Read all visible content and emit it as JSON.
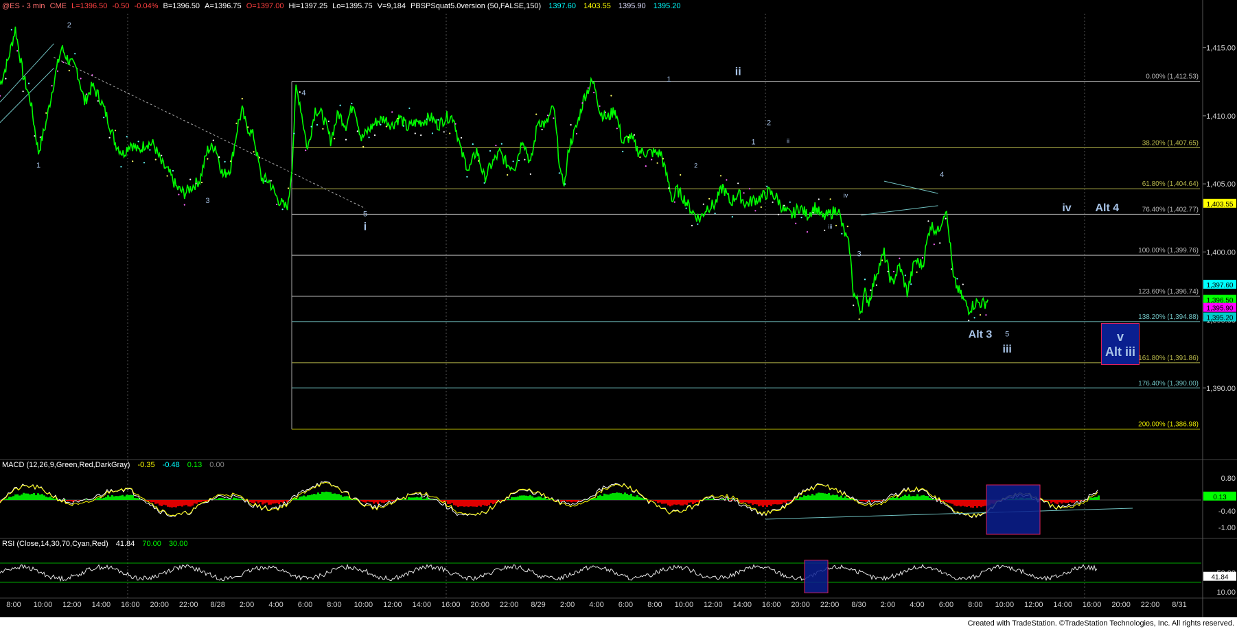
{
  "header": {
    "symbol": "@ES - 3 min",
    "exchange": "CME",
    "last": "L=1396.50",
    "change": "-0.50",
    "change_pct": "-0.04%",
    "bid": "B=1396.50",
    "ask": "A=1396.75",
    "open": "O=1397.00",
    "high": "Hi=1397.25",
    "low": "Lo=1395.75",
    "volume": "V=9,184",
    "study": "PBSPSquat5.0version (50,FALSE,150)",
    "study_v1": "1397.60",
    "study_v2": "1403.55",
    "study_v3": "1395.90",
    "study_v4": "1395.20"
  },
  "colors": {
    "price": "#00ff00",
    "fib_gray": "#b8b8b8",
    "fib_olive": "#b5b54a",
    "fib_teal": "#6fc0c0",
    "fib_yellow": "#e6e600",
    "label": "#a8c4e8",
    "box_fill": "#0a1f8f",
    "box_border": "#e0205a"
  },
  "chart_data": [
    {
      "type": "line",
      "name": "price",
      "ylim": [
        1385.0,
        1417.5
      ],
      "yticks": [
        "1,415.00",
        "1,410.00",
        "1,405.00",
        "1,400.00",
        "1,395.00",
        "1,390.00"
      ],
      "yticks_values": [
        1415,
        1410,
        1405,
        1400,
        1395,
        1390
      ],
      "x_labels": [
        "8:00",
        "10:00",
        "12:00",
        "14:00",
        "16:00",
        "20:00",
        "22:00",
        "8/28",
        "2:00",
        "4:00",
        "6:00",
        "8:00",
        "10:00",
        "12:00",
        "14:00",
        "16:00",
        "20:00",
        "22:00",
        "8/29",
        "2:00",
        "4:00",
        "6:00",
        "8:00",
        "10:00",
        "12:00",
        "14:00",
        "16:00",
        "20:00",
        "22:00",
        "8/30",
        "2:00",
        "4:00",
        "6:00",
        "8:00",
        "10:00",
        "12:00",
        "14:00",
        "16:00",
        "20:00",
        "22:00",
        "8/31"
      ],
      "price_path": [
        [
          0,
          1412.3
        ],
        [
          4,
          1414.0
        ],
        [
          8,
          1416.4
        ],
        [
          12,
          1413.0
        ],
        [
          16,
          1411.0
        ],
        [
          20,
          1407.3
        ],
        [
          24,
          1409.5
        ],
        [
          28,
          1412.5
        ],
        [
          32,
          1415.0
        ],
        [
          36,
          1414.0
        ],
        [
          40,
          1413.4
        ],
        [
          44,
          1411.0
        ],
        [
          48,
          1412.2
        ],
        [
          52,
          1411.3
        ],
        [
          56,
          1409.8
        ],
        [
          60,
          1408.0
        ],
        [
          64,
          1407.2
        ],
        [
          68,
          1408.0
        ],
        [
          72,
          1407.4
        ],
        [
          76,
          1408.0
        ],
        [
          80,
          1407.9
        ],
        [
          84,
          1406.5
        ],
        [
          88,
          1405.8
        ],
        [
          92,
          1404.7
        ],
        [
          96,
          1404.3
        ],
        [
          100,
          1404.8
        ],
        [
          104,
          1405.3
        ],
        [
          108,
          1407.5
        ],
        [
          112,
          1407.8
        ],
        [
          116,
          1405.6
        ],
        [
          120,
          1406.2
        ],
        [
          124,
          1409.5
        ],
        [
          126,
          1410.4
        ],
        [
          128,
          1409.3
        ],
        [
          132,
          1408.5
        ],
        [
          136,
          1405.4
        ],
        [
          140,
          1405.2
        ],
        [
          144,
          1404.0
        ],
        [
          148,
          1403.3
        ],
        [
          150,
          1403.5
        ],
        [
          152,
          1406.5
        ],
        [
          154,
          1412.0
        ],
        [
          156,
          1411.0
        ],
        [
          160,
          1407.5
        ],
        [
          164,
          1410.5
        ],
        [
          168,
          1410.0
        ],
        [
          172,
          1408.2
        ],
        [
          176,
          1410.2
        ],
        [
          180,
          1409.3
        ],
        [
          184,
          1411.0
        ],
        [
          188,
          1408.3
        ],
        [
          192,
          1409.0
        ],
        [
          196,
          1409.6
        ],
        [
          200,
          1409.8
        ],
        [
          204,
          1409.3
        ],
        [
          208,
          1409.9
        ],
        [
          212,
          1409.1
        ],
        [
          216,
          1409.5
        ],
        [
          220,
          1409.6
        ],
        [
          224,
          1409.9
        ],
        [
          228,
          1409.3
        ],
        [
          232,
          1409.9
        ],
        [
          236,
          1409.9
        ],
        [
          240,
          1407.3
        ],
        [
          244,
          1406.0
        ],
        [
          248,
          1407.5
        ],
        [
          252,
          1405.4
        ],
        [
          256,
          1406.5
        ],
        [
          260,
          1407.3
        ],
        [
          264,
          1406.4
        ],
        [
          268,
          1406.3
        ],
        [
          272,
          1408.4
        ],
        [
          276,
          1406.4
        ],
        [
          280,
          1409.7
        ],
        [
          284,
          1409.3
        ],
        [
          288,
          1410.7
        ],
        [
          292,
          1405.3
        ],
        [
          294,
          1405.2
        ],
        [
          296,
          1407.7
        ],
        [
          300,
          1409.2
        ],
        [
          304,
          1411.4
        ],
        [
          308,
          1412.5
        ],
        [
          310,
          1412.0
        ],
        [
          312,
          1410.3
        ],
        [
          316,
          1409.8
        ],
        [
          320,
          1410.5
        ],
        [
          324,
          1408.0
        ],
        [
          328,
          1408.5
        ],
        [
          332,
          1407.4
        ],
        [
          336,
          1407.3
        ],
        [
          340,
          1407.3
        ],
        [
          344,
          1407.2
        ],
        [
          346,
          1406.0
        ],
        [
          348,
          1405.0
        ],
        [
          350,
          1403.7
        ],
        [
          352,
          1404.6
        ],
        [
          356,
          1403.9
        ],
        [
          360,
          1403.0
        ],
        [
          364,
          1402.4
        ],
        [
          368,
          1403.3
        ],
        [
          372,
          1403.5
        ],
        [
          376,
          1404.8
        ],
        [
          380,
          1403.6
        ],
        [
          384,
          1404.3
        ],
        [
          388,
          1403.5
        ],
        [
          392,
          1403.8
        ],
        [
          396,
          1404.0
        ],
        [
          400,
          1404.4
        ],
        [
          404,
          1404.0
        ],
        [
          408,
          1403.0
        ],
        [
          412,
          1402.7
        ],
        [
          416,
          1403.3
        ],
        [
          420,
          1402.7
        ],
        [
          424,
          1403.3
        ],
        [
          428,
          1402.5
        ],
        [
          432,
          1402.8
        ],
        [
          436,
          1403.2
        ],
        [
          438,
          1402.0
        ],
        [
          442,
          1400.3
        ],
        [
          444,
          1397.0
        ],
        [
          446,
          1396.4
        ],
        [
          448,
          1395.7
        ],
        [
          450,
          1397.0
        ],
        [
          452,
          1396.3
        ],
        [
          456,
          1398.5
        ],
        [
          460,
          1399.9
        ],
        [
          464,
          1397.6
        ],
        [
          468,
          1399.0
        ],
        [
          472,
          1397.0
        ],
        [
          476,
          1399.4
        ],
        [
          480,
          1399.0
        ],
        [
          484,
          1402.0
        ],
        [
          488,
          1401.5
        ],
        [
          492,
          1403.2
        ],
        [
          494,
          1401.0
        ],
        [
          496,
          1398.0
        ],
        [
          500,
          1396.8
        ],
        [
          504,
          1395.8
        ],
        [
          508,
          1396.3
        ],
        [
          512,
          1396.2
        ],
        [
          514,
          1396.5
        ]
      ],
      "price_x_max": 625,
      "fib_levels": [
        {
          "label": "0.00% (1,412.53)",
          "value": 1412.53,
          "color": "gray"
        },
        {
          "label": "38.20% (1,407.65)",
          "value": 1407.65,
          "color": "olive"
        },
        {
          "label": "61.80% (1,404.64)",
          "value": 1404.64,
          "color": "olive"
        },
        {
          "label": "76.40% (1,402.77)",
          "value": 1402.77,
          "color": "gray"
        },
        {
          "label": "100.00% (1,399.76)",
          "value": 1399.76,
          "color": "gray"
        },
        {
          "label": "123.60% (1,396.74)",
          "value": 1396.74,
          "color": "gray"
        },
        {
          "label": "138.20% (1,394.88)",
          "value": 1394.88,
          "color": "teal"
        },
        {
          "label": "161.80% (1,391.86)",
          "value": 1391.86,
          "color": "olive"
        },
        {
          "label": "176.40% (1,390.00)",
          "value": 1390.0,
          "color": "teal"
        },
        {
          "label": "200.00% (1,386.98)",
          "value": 1386.98,
          "color": "yellow"
        }
      ],
      "price_markers": [
        {
          "label": "1,403.55",
          "value": 1403.55,
          "bg": "#ffff00",
          "fg": "#000000"
        },
        {
          "label": "1,397.60",
          "value": 1397.6,
          "bg": "#00ffff",
          "fg": "#000000"
        },
        {
          "label": "1,396.50",
          "value": 1396.5,
          "bg": "#00ff00",
          "fg": "#000000"
        },
        {
          "label": "1,395.90",
          "value": 1395.9,
          "bg": "#ff00ff",
          "fg": "#000000"
        },
        {
          "label": "1,395.20",
          "value": 1395.2,
          "bg": "#00cccc",
          "fg": "#000000"
        }
      ],
      "wave_labels": [
        {
          "text": "1",
          "x": 20,
          "y": 1406.2,
          "size": "s"
        },
        {
          "text": "2",
          "x": 36,
          "y": 1416.5,
          "size": "s"
        },
        {
          "text": "3",
          "x": 108,
          "y": 1403.6,
          "size": "s"
        },
        {
          "text": "4",
          "x": 158,
          "y": 1411.5,
          "size": "s"
        },
        {
          "text": "5",
          "x": 190,
          "y": 1402.6,
          "size": "s"
        },
        {
          "text": "i",
          "x": 190,
          "y": 1401.6,
          "size": "m"
        },
        {
          "text": "1",
          "x": 348,
          "y": 1412.5,
          "size": "s"
        },
        {
          "text": "ii",
          "x": 384,
          "y": 1413.0,
          "size": "m"
        },
        {
          "text": "2",
          "x": 400,
          "y": 1409.3,
          "size": "s"
        },
        {
          "text": "1",
          "x": 392,
          "y": 1407.9,
          "size": "s"
        },
        {
          "text": "ii",
          "x": 410,
          "y": 1408.0,
          "size": "xs"
        },
        {
          "text": "2",
          "x": 362,
          "y": 1406.2,
          "size": "xs"
        },
        {
          "text": "iii",
          "x": 432,
          "y": 1401.7,
          "size": "xs"
        },
        {
          "text": "iv",
          "x": 440,
          "y": 1404.0,
          "size": "xs"
        },
        {
          "text": "3",
          "x": 447,
          "y": 1399.7,
          "size": "s"
        },
        {
          "text": "4",
          "x": 490,
          "y": 1405.5,
          "size": "s"
        },
        {
          "text": "iv",
          "x": 555,
          "y": 1403.0,
          "size": "m"
        },
        {
          "text": "Alt 4",
          "x": 576,
          "y": 1403.0,
          "size": "m"
        },
        {
          "text": "Alt 3",
          "x": 510,
          "y": 1393.7,
          "size": "m"
        },
        {
          "text": "5",
          "x": 524,
          "y": 1393.8,
          "size": "s"
        },
        {
          "text": "iii",
          "x": 524,
          "y": 1392.6,
          "size": "m"
        }
      ],
      "target_box": {
        "line1": "v",
        "line2": "Alt iii",
        "top": 1394.8,
        "bottom": 1391.8,
        "x0": 573,
        "x1": 592
      }
    },
    {
      "type": "line",
      "name": "MACD",
      "title": "MACD (12,26,9,Green,Red,DarkGray)",
      "values_text": [
        "-0.35",
        "-0.48",
        "0.13",
        "0.00"
      ],
      "ylim": [
        -1.4,
        1.1
      ],
      "yticks": [
        "0.80",
        "0.13",
        "-0.40",
        "-1.00"
      ],
      "yticks_values": [
        0.8,
        0.13,
        -0.4,
        -1.0
      ]
    },
    {
      "type": "line",
      "name": "RSI",
      "title": "RSI (Close,14,30,70,Cyan,Red)",
      "values_text": [
        "41.84",
        "70.00",
        "30.00"
      ],
      "ylim": [
        0,
        100
      ],
      "yticks": [
        "50.00",
        "41.84",
        "10.00"
      ],
      "yticks_values": [
        50,
        41.84,
        10
      ]
    }
  ],
  "footer": {
    "text": "Created with TradeStation. ©TradeStation Technologies, Inc. All rights reserved."
  }
}
